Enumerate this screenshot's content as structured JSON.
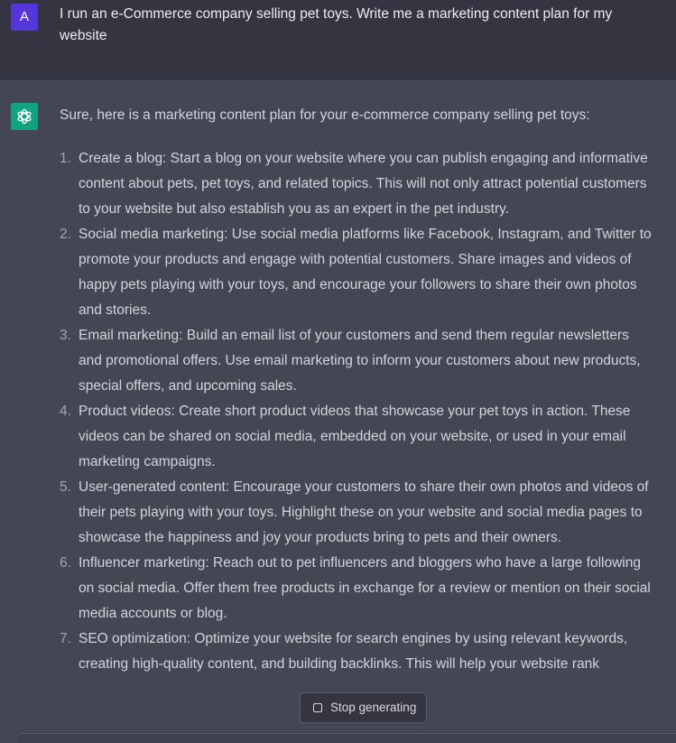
{
  "user": {
    "avatar_letter": "A",
    "prompt": "I run an e-Commerce company selling pet toys. Write me a marketing content plan for my website"
  },
  "assistant": {
    "icon": "openai-logo-icon",
    "intro": "Sure, here is a marketing content plan for your e-commerce company selling pet toys:",
    "items": [
      {
        "num": "1.",
        "text": "Create a blog: Start a blog on your website where you can publish engaging and informative content about pets, pet toys, and related topics. This will not only attract potential customers to your website but also establish you as an expert in the pet industry."
      },
      {
        "num": "2.",
        "text": "Social media marketing: Use social media platforms like Facebook, Instagram, and Twitter to promote your products and engage with potential customers. Share images and videos of happy pets playing with your toys, and encourage your followers to share their own photos and stories."
      },
      {
        "num": "3.",
        "text": "Email marketing: Build an email list of your customers and send them regular newsletters and promotional offers. Use email marketing to inform your customers about new products, special offers, and upcoming sales."
      },
      {
        "num": "4.",
        "text": "Product videos: Create short product videos that showcase your pet toys in action. These videos can be shared on social media, embedded on your website, or used in your email marketing campaigns."
      },
      {
        "num": "5.",
        "text": "User-generated content: Encourage your customers to share their own photos and videos of their pets playing with your toys. Highlight these on your website and social media pages to showcase the happiness and joy your products bring to pets and their owners."
      },
      {
        "num": "6.",
        "text": "Influencer marketing: Reach out to pet influencers and bloggers who have a large following on social media. Offer them free products in exchange for a review or mention on their social media accounts or blog."
      },
      {
        "num": "7.",
        "text": "SEO optimization: Optimize your website for search engines by using relevant keywords, creating high-quality content, and building backlinks. This will help your website rank"
      }
    ]
  },
  "controls": {
    "stop_label": "Stop generating",
    "stop_icon": "stop-square-icon"
  },
  "colors": {
    "user_bg": "#343541",
    "assistant_bg": "#444654",
    "user_avatar": "#5436da",
    "gpt_avatar": "#10a37f"
  }
}
